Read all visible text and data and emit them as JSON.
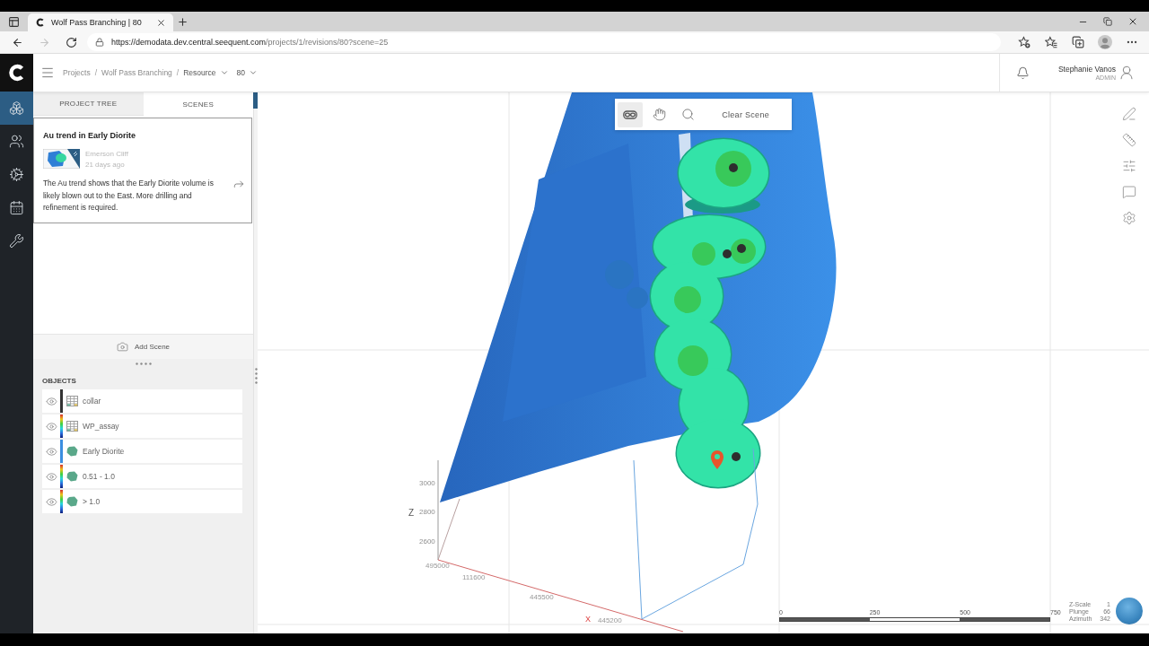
{
  "browser": {
    "tab": {
      "title": "Wolf Pass Branching | 80",
      "selected": true
    },
    "nav_buttons": [
      {
        "kind": "back",
        "disabled": false
      },
      {
        "kind": "forward",
        "disabled": true
      },
      {
        "kind": "reload",
        "disabled": false
      }
    ],
    "url": {
      "host": "https://demodata.dev.central.seequent.com",
      "path": "/projects/1/revisions/80?scene=25"
    },
    "toolbar": [
      {
        "kind": "add_favorite"
      },
      {
        "kind": "favorites"
      },
      {
        "kind": "collections"
      },
      {
        "kind": "profile"
      },
      {
        "kind": "more"
      }
    ]
  },
  "header": {
    "separator": "/",
    "breadcrumbs": [
      {
        "label": "Projects",
        "kind": "link"
      },
      {
        "label": "Wolf Pass Branching",
        "kind": "link"
      },
      {
        "label": "Resource",
        "kind": "dropdown"
      },
      {
        "label": "80",
        "kind": "dropdown"
      }
    ],
    "user": {
      "name": "Stephanie Vanos",
      "role": "ADMIN"
    }
  },
  "sidebar": {
    "items": [
      {
        "kind": "models",
        "selected": true
      },
      {
        "kind": "users",
        "selected": false
      },
      {
        "kind": "settings",
        "selected": false
      },
      {
        "kind": "calendar",
        "selected": false
      },
      {
        "kind": "tools",
        "selected": false
      }
    ]
  },
  "panel": {
    "tabs": [
      {
        "label": "PROJECT TREE",
        "selected": false
      },
      {
        "label": "SCENES",
        "selected": true
      }
    ],
    "scenes": [
      {
        "title": "Au trend in Early Diorite",
        "author": "Emerson Cliff",
        "time": "21 days ago",
        "description": "The Au trend shows that the Early Diorite volume is likely blown out to the East. More drilling and refinement is required."
      }
    ],
    "add_scene": "Add Scene",
    "objects": {
      "title": "OBJECTS",
      "rows": [
        {
          "label": "collar",
          "kind": "points",
          "visible": true,
          "legend": {
            "kind": "solid",
            "color": "#333333"
          }
        },
        {
          "label": "WP_assay",
          "kind": "points",
          "visible": true,
          "legend": {
            "kind": "colormap"
          }
        },
        {
          "label": "Early Diorite",
          "kind": "surface",
          "visible": true,
          "legend": {
            "kind": "solid",
            "color": "#3b8ee0"
          }
        },
        {
          "label": "0.51 - 1.0",
          "kind": "surface",
          "visible": true,
          "legend": {
            "kind": "colormap"
          }
        },
        {
          "label": "> 1.0",
          "kind": "surface",
          "visible": true,
          "legend": {
            "kind": "colormap"
          }
        }
      ]
    }
  },
  "viewport": {
    "tools": [
      {
        "kind": "vr",
        "selected": true
      },
      {
        "kind": "pan",
        "selected": false
      },
      {
        "kind": "zoom",
        "selected": false
      }
    ],
    "clear_label": "Clear Scene",
    "axes": {
      "z_label": "Z",
      "x_label": "X",
      "z_ticks": [
        "3000",
        "2800",
        "2600"
      ],
      "ground_ticks": [
        "495000",
        "111600",
        "445500",
        "445200"
      ]
    },
    "scale_bar": [
      "0",
      "250",
      "500",
      "750"
    ],
    "orientation": [
      {
        "label": "Z-Scale",
        "value": "1"
      },
      {
        "label": "Plunge",
        "value": "66"
      },
      {
        "label": "Azimuth",
        "value": "342"
      }
    ],
    "side_tools": [
      {
        "kind": "draw"
      },
      {
        "kind": "measure"
      },
      {
        "kind": "filters"
      },
      {
        "kind": "comments"
      },
      {
        "kind": "settings"
      }
    ]
  }
}
